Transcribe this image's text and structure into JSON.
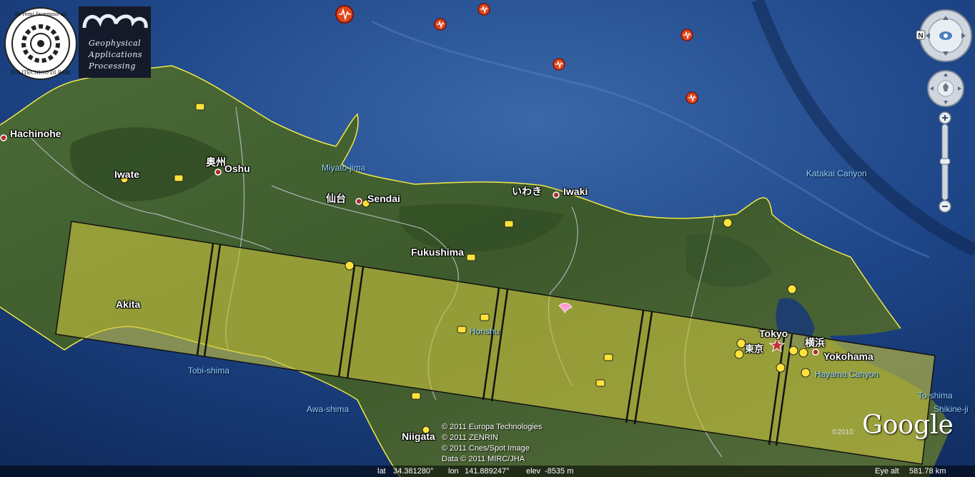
{
  "logos": {
    "university_motto": "de remi facemmo ali",
    "university_name": "POLITECNICO DI BARI",
    "gap_line1": "Geophysical",
    "gap_line2": "Applications",
    "gap_line3": "Processing"
  },
  "places": [
    {
      "id": "hachinohe",
      "text": "Hachinohe",
      "type": "city"
    },
    {
      "id": "iwate",
      "text": "Iwate",
      "type": "land"
    },
    {
      "id": "oshu-jp",
      "text": "奥州",
      "type": "jp"
    },
    {
      "id": "oshu",
      "text": "Oshu",
      "type": "land"
    },
    {
      "id": "miyato",
      "text": "Miyato-jima",
      "type": "water"
    },
    {
      "id": "sendai-jp",
      "text": "仙台",
      "type": "jp"
    },
    {
      "id": "sendai",
      "text": "Sendai",
      "type": "land"
    },
    {
      "id": "iwaki-jp",
      "text": "いわき",
      "type": "jp"
    },
    {
      "id": "iwaki",
      "text": "Iwaki",
      "type": "land"
    },
    {
      "id": "katakai",
      "text": "Katakai Canyon",
      "type": "water"
    },
    {
      "id": "fukushima",
      "text": "Fukushima",
      "type": "land"
    },
    {
      "id": "akita",
      "text": "Akita",
      "type": "land"
    },
    {
      "id": "honshu",
      "text": "Honshu",
      "type": "water"
    },
    {
      "id": "tokyo",
      "text": "Tokyo",
      "type": "land"
    },
    {
      "id": "tokyo-jp",
      "text": "東京",
      "type": "jp"
    },
    {
      "id": "yokohama-jp",
      "text": "横浜",
      "type": "jp"
    },
    {
      "id": "yokohama",
      "text": "Yokohama",
      "type": "land"
    },
    {
      "id": "hayama",
      "text": "Hayama Canyon",
      "type": "water"
    },
    {
      "id": "tobishima",
      "text": "Tobi-shima",
      "type": "water"
    },
    {
      "id": "awashima",
      "text": "Awa-shima",
      "type": "water"
    },
    {
      "id": "niigata",
      "text": "Niigata",
      "type": "land"
    },
    {
      "id": "toshima",
      "text": "To-shima",
      "type": "water"
    },
    {
      "id": "shikine",
      "text": "Shikine-ji",
      "type": "water"
    }
  ],
  "copyright": [
    "© 2011 Europa Technologies",
    "© 2011 ZENRIN",
    "© 2011 Cnes/Spot Image",
    "Data © 2011 MIRC/JHA"
  ],
  "brand": "Google",
  "year_badge": "©2010",
  "status": {
    "lat_label": "lat",
    "lat_value": "34.381280°",
    "lon_label": "lon",
    "lon_value": "141.889247°",
    "elev_label": "elev",
    "elev_value": "-8535 m",
    "eye_label": "Eye alt",
    "eye_value": "581.78 km"
  },
  "nav": {
    "north_label": "N"
  },
  "colors": {
    "ocean": "#1b3f7a",
    "land": "#3f5a2e",
    "swath": "#b8b43c",
    "coast": "#f2e84a",
    "quake": "#e0461e"
  }
}
